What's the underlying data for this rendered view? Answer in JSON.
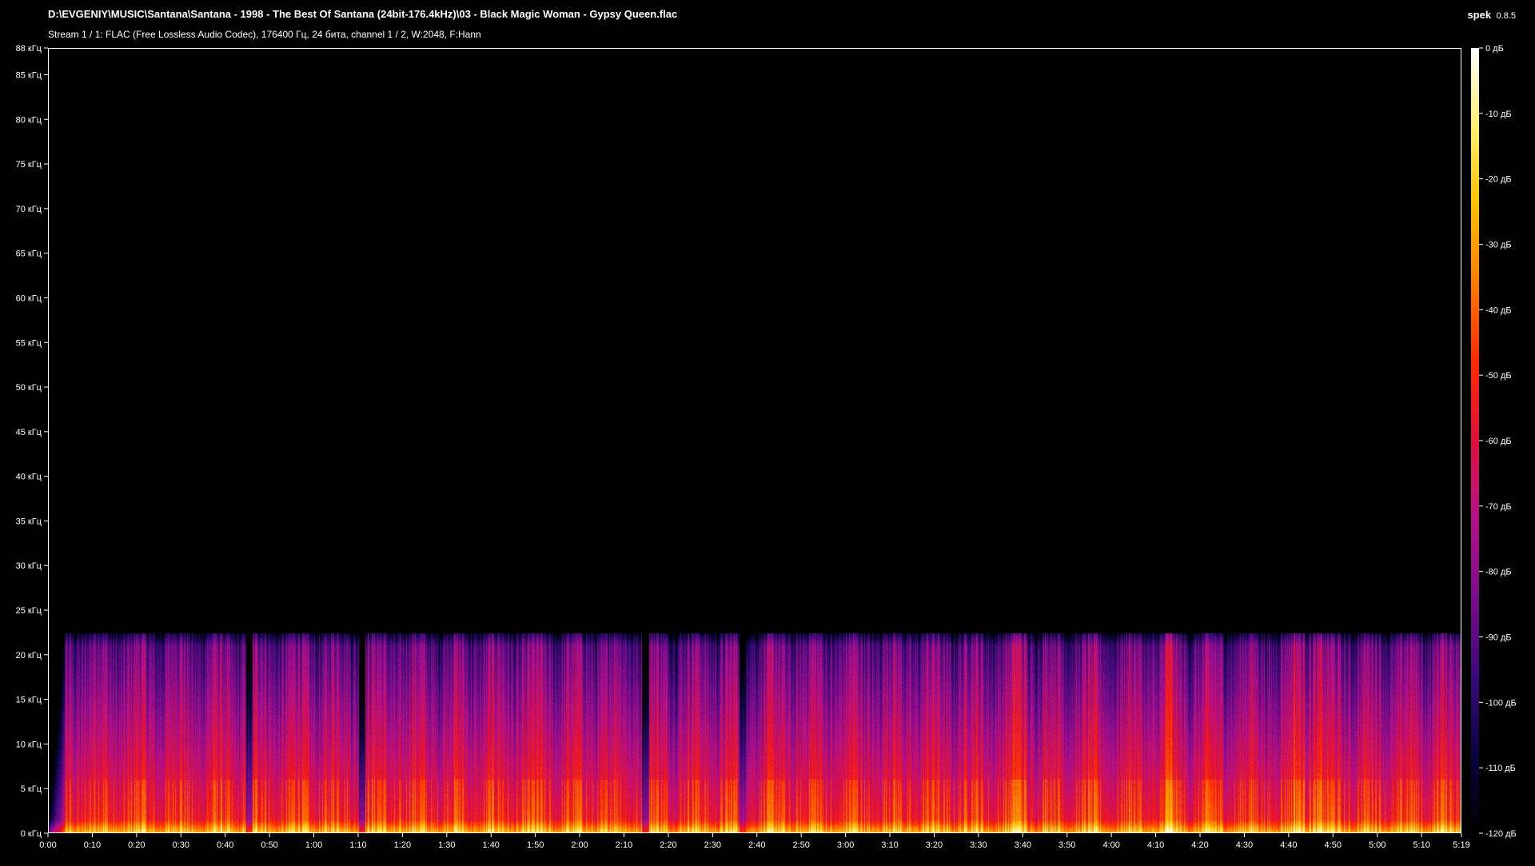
{
  "window": {
    "file_path": "D:\\EVGENIY\\MUSIC\\Santana\\Santana - 1998 - The Best Of Santana (24bit-176.4kHz)\\03 - Black Magic Woman - Gypsy Queen.flac",
    "stream_info": "Stream 1 / 1: FLAC (Free Lossless Audio Codec), 176400 Гц, 24 бита, channel 1 / 2, W:2048, F:Hann",
    "app_name": "spek",
    "app_version": "0.8.5"
  },
  "chart_data": {
    "type": "heatmap",
    "title": "",
    "xlabel": "",
    "ylabel": "",
    "x_unit": "time",
    "y_unit": "кГц",
    "ylim": [
      0,
      88
    ],
    "xlim_seconds": [
      0,
      319
    ],
    "y_ticks": [
      {
        "value": 0,
        "label": "0 кГц"
      },
      {
        "value": 5,
        "label": "5 кГц"
      },
      {
        "value": 10,
        "label": "10 кГц"
      },
      {
        "value": 15,
        "label": "15 кГц"
      },
      {
        "value": 20,
        "label": "20 кГц"
      },
      {
        "value": 25,
        "label": "25 кГц"
      },
      {
        "value": 30,
        "label": "30 кГц"
      },
      {
        "value": 35,
        "label": "35 кГц"
      },
      {
        "value": 40,
        "label": "40 кГц"
      },
      {
        "value": 45,
        "label": "45 кГц"
      },
      {
        "value": 50,
        "label": "50 кГц"
      },
      {
        "value": 55,
        "label": "55 кГц"
      },
      {
        "value": 60,
        "label": "60 кГц"
      },
      {
        "value": 65,
        "label": "65 кГц"
      },
      {
        "value": 70,
        "label": "70 кГц"
      },
      {
        "value": 75,
        "label": "75 кГц"
      },
      {
        "value": 80,
        "label": "80 кГц"
      },
      {
        "value": 85,
        "label": "85 кГц"
      },
      {
        "value": 88,
        "label": "88 кГц"
      }
    ],
    "x_ticks": [
      {
        "value": 0,
        "label": "0:00"
      },
      {
        "value": 10,
        "label": "0:10"
      },
      {
        "value": 20,
        "label": "0:20"
      },
      {
        "value": 30,
        "label": "0:30"
      },
      {
        "value": 40,
        "label": "0:40"
      },
      {
        "value": 50,
        "label": "0:50"
      },
      {
        "value": 60,
        "label": "1:00"
      },
      {
        "value": 70,
        "label": "1:10"
      },
      {
        "value": 80,
        "label": "1:20"
      },
      {
        "value": 90,
        "label": "1:30"
      },
      {
        "value": 100,
        "label": "1:40"
      },
      {
        "value": 110,
        "label": "1:50"
      },
      {
        "value": 120,
        "label": "2:00"
      },
      {
        "value": 130,
        "label": "2:10"
      },
      {
        "value": 140,
        "label": "2:20"
      },
      {
        "value": 150,
        "label": "2:30"
      },
      {
        "value": 160,
        "label": "2:40"
      },
      {
        "value": 170,
        "label": "2:50"
      },
      {
        "value": 180,
        "label": "3:00"
      },
      {
        "value": 190,
        "label": "3:10"
      },
      {
        "value": 200,
        "label": "3:20"
      },
      {
        "value": 210,
        "label": "3:30"
      },
      {
        "value": 220,
        "label": "3:40"
      },
      {
        "value": 230,
        "label": "3:50"
      },
      {
        "value": 240,
        "label": "4:00"
      },
      {
        "value": 250,
        "label": "4:10"
      },
      {
        "value": 260,
        "label": "4:20"
      },
      {
        "value": 270,
        "label": "4:30"
      },
      {
        "value": 280,
        "label": "4:40"
      },
      {
        "value": 290,
        "label": "4:50"
      },
      {
        "value": 300,
        "label": "5:00"
      },
      {
        "value": 310,
        "label": "5:10"
      },
      {
        "value": 319,
        "label": "5:19"
      }
    ],
    "colorbar": {
      "range_db": [
        -120,
        0
      ],
      "ticks": [
        {
          "value": 0,
          "label": "0 дБ"
        },
        {
          "value": -10,
          "label": "-10 дБ"
        },
        {
          "value": -20,
          "label": "-20 дБ"
        },
        {
          "value": -30,
          "label": "-30 дБ"
        },
        {
          "value": -40,
          "label": "-40 дБ"
        },
        {
          "value": -50,
          "label": "-50 дБ"
        },
        {
          "value": -60,
          "label": "-60 дБ"
        },
        {
          "value": -70,
          "label": "-70 дБ"
        },
        {
          "value": -80,
          "label": "-80 дБ"
        },
        {
          "value": -90,
          "label": "-90 дБ"
        },
        {
          "value": -100,
          "label": "-100 дБ"
        },
        {
          "value": -110,
          "label": "-110 дБ"
        },
        {
          "value": -120,
          "label": "-120 дБ"
        }
      ],
      "colors": [
        "#000000",
        "#0a0440",
        "#3a0a7a",
        "#7a0c8a",
        "#b5108a",
        "#e0103a",
        "#ff2a00",
        "#ff7a00",
        "#ffc000",
        "#fff070",
        "#ffffff"
      ]
    },
    "spectrum": {
      "content_cutoff_khz": 22,
      "quiet_gaps_seconds": [
        [
          0,
          3
        ],
        [
          44.5,
          45.5
        ],
        [
          70,
          71
        ],
        [
          134,
          135
        ],
        [
          156,
          157
        ],
        [
          319,
          319
        ]
      ],
      "bright_bursts_seconds": [
        [
          218,
          221
        ],
        [
          252,
          254
        ],
        [
          281,
          288
        ],
        [
          313,
          315
        ]
      ]
    }
  }
}
